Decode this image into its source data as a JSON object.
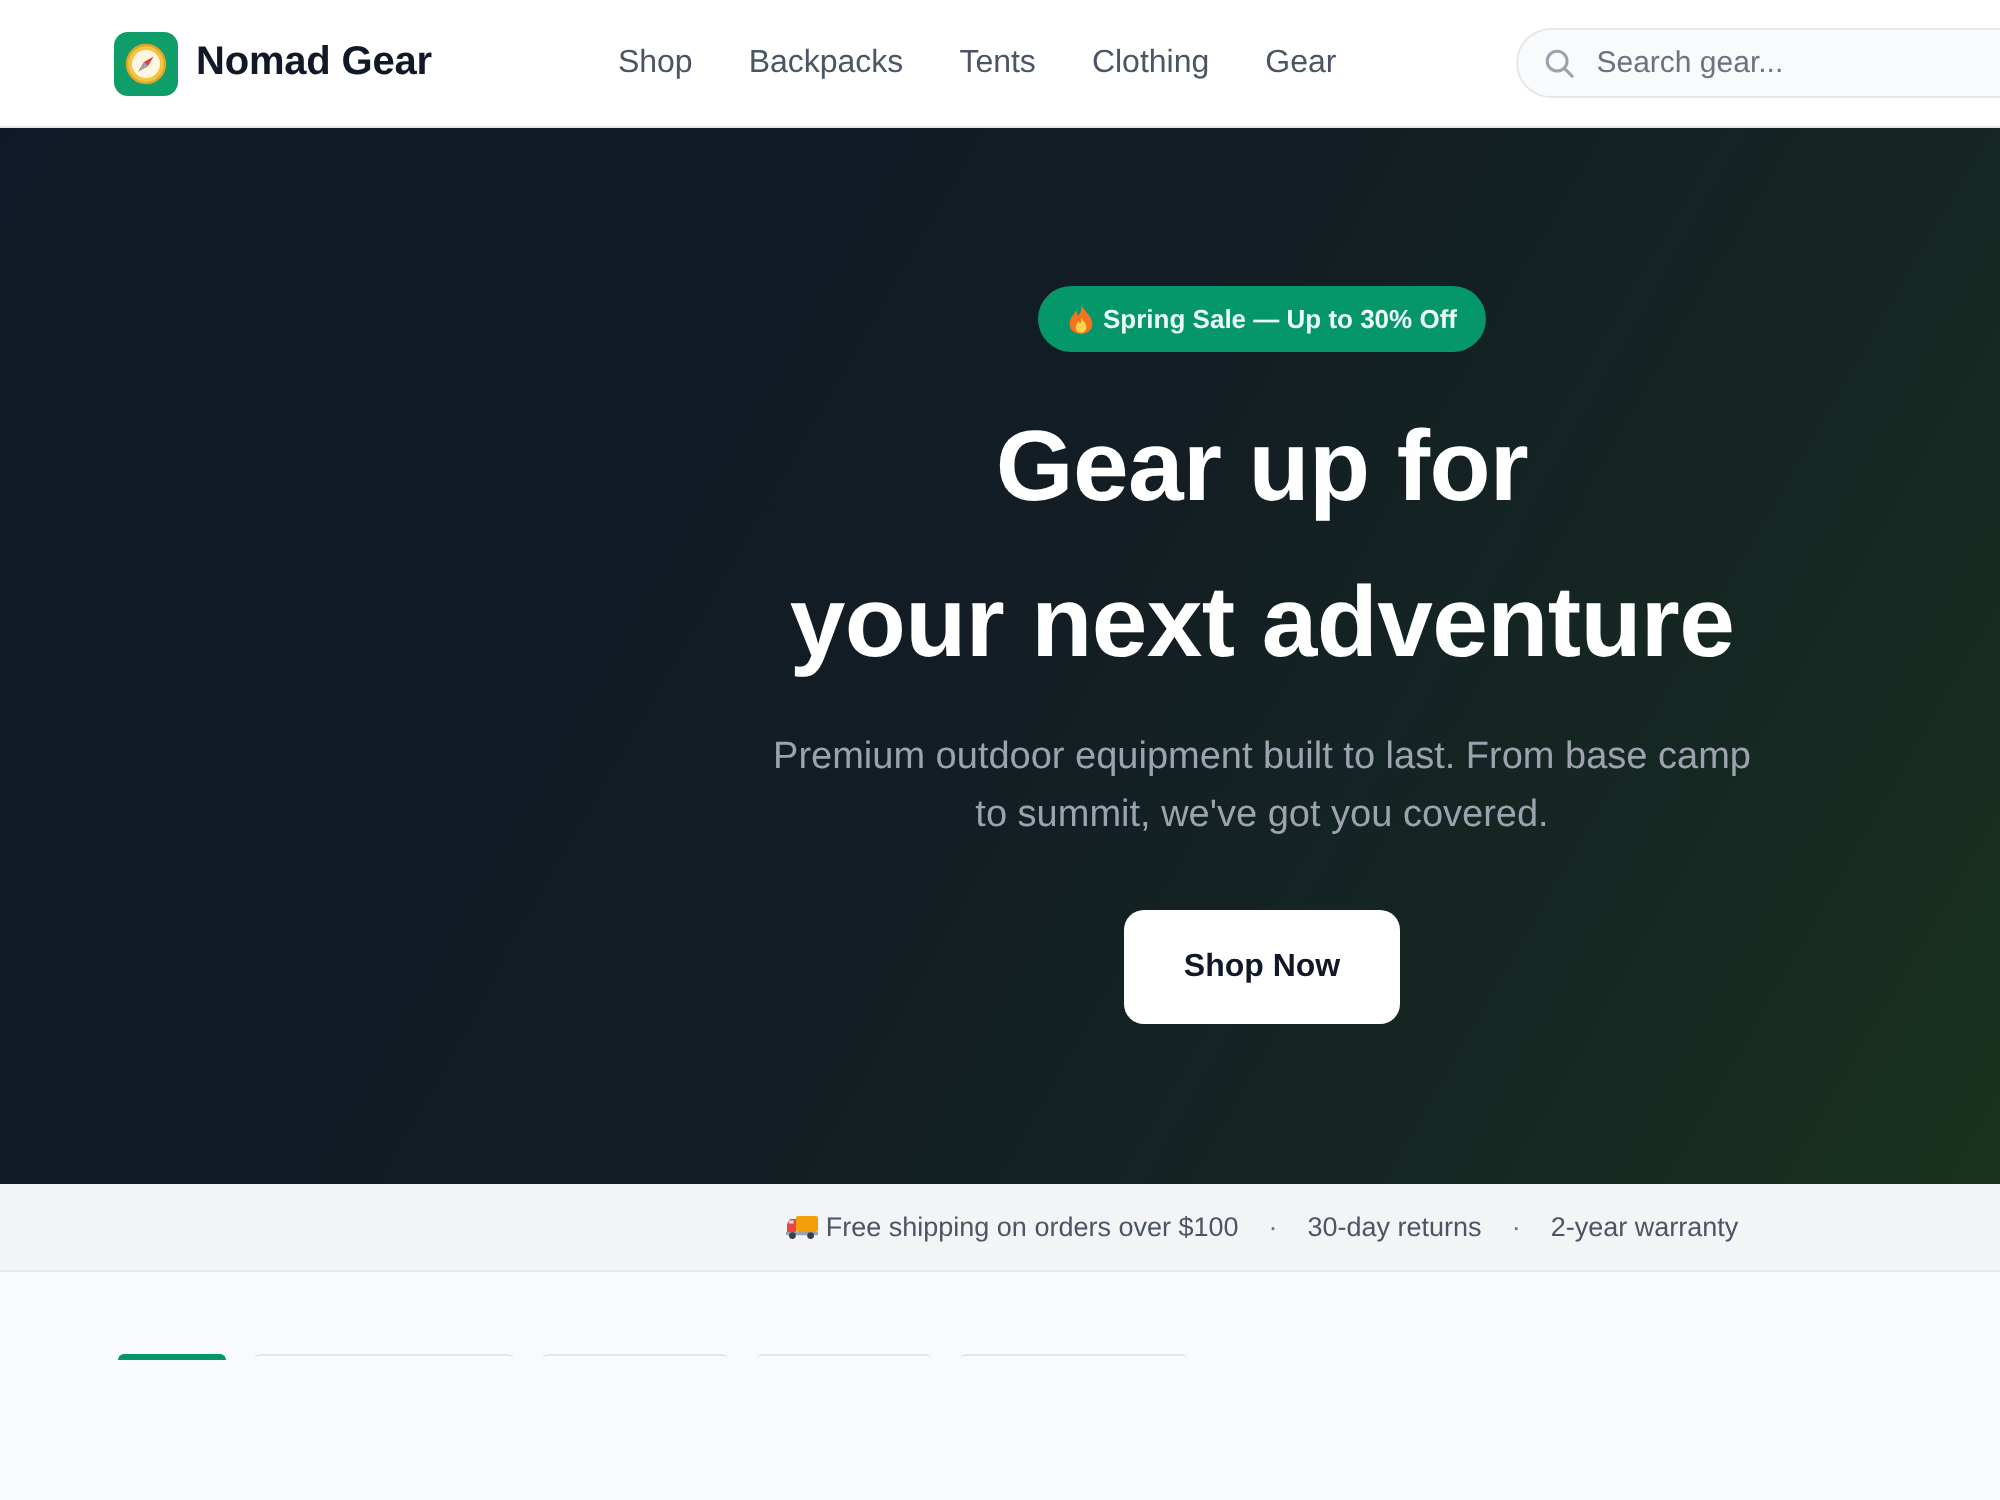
{
  "header": {
    "brand": "Nomad Gear",
    "nav_links": [
      "Shop",
      "Backpacks",
      "Tents",
      "Clothing",
      "Gear"
    ],
    "search": {
      "placeholder": "Search gear..."
    }
  },
  "hero": {
    "badge": "Spring Sale — Up to 30% Off",
    "title_lines": [
      "Gear up for",
      "your next adventure"
    ],
    "subtitle": "Premium outdoor equipment built to last. From base camp to summit, we've got you covered.",
    "button": "Shop Now"
  },
  "perks_bar": {
    "items": [
      {
        "kind": "icon",
        "text": "Free shipping on orders over $100"
      },
      {
        "kind": "plain",
        "text": "30-day returns"
      },
      {
        "kind": "plain",
        "text": "2-year warranty"
      }
    ],
    "separators": [
      "·",
      "·"
    ]
  },
  "category_pills": [
    {
      "selected": true
    },
    {
      "selected": false
    },
    {
      "selected": false
    },
    {
      "selected": false
    },
    {
      "selected": false
    }
  ]
}
